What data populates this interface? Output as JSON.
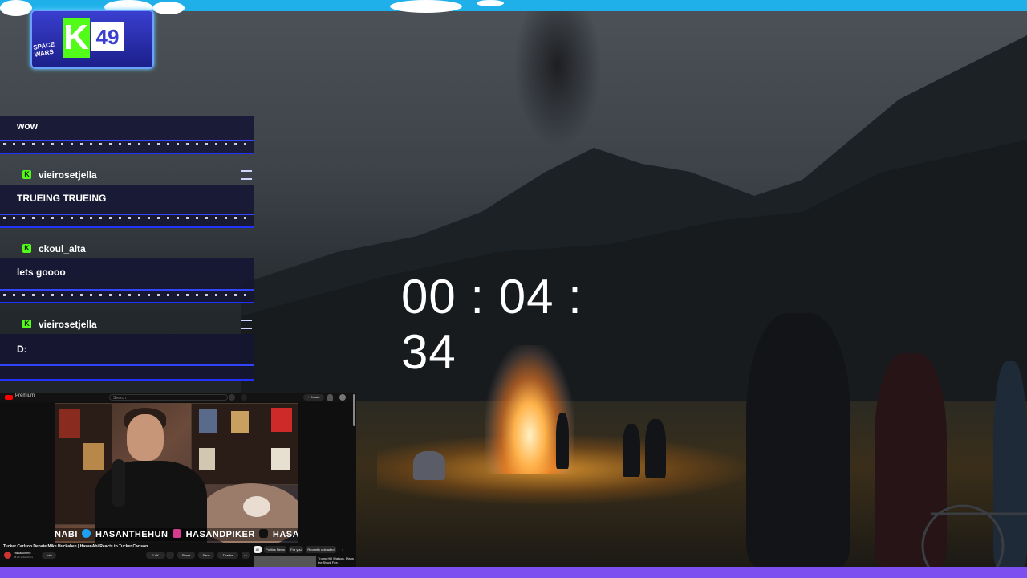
{
  "chat": {
    "messages": [
      {
        "text": "wow"
      },
      {
        "username": "vieirosetjella",
        "text": "TRUEING TRUEING"
      },
      {
        "username": "ckoul_alta",
        "text": "lets goooo"
      },
      {
        "username": "vieirosetjella",
        "text": "D:"
      }
    ],
    "platform_badge": "K"
  },
  "logo": {
    "letter": "K",
    "number": "49",
    "side_text": "SPACE WARS"
  },
  "timer": {
    "display": "00 : 04 : 34"
  },
  "youtube": {
    "premium_label": "Premium",
    "search_placeholder": "Search",
    "create_label": "+ Create",
    "video_title": "Tucker Carlson Debate Mike Huckabee | HasanAbi Reacts to Tucker Carlson",
    "channel_name": "Hasanonme",
    "channel_subs": "95.2K subscribers",
    "join_label": "Join",
    "like_count": "1.6K",
    "share_label": "Share",
    "save_label": "Save",
    "thanks_label": "Thanks",
    "banner_text": [
      "NABI",
      "HASANTHEHUN",
      "HASANDPIKER",
      "HASANDPIKER"
    ],
    "chips": [
      "All",
      "Politics News",
      "For you",
      "Recently uploaded"
    ],
    "rec_title": "Trump Hill Watson. Plans the Stock Fee."
  },
  "colors": {
    "top_bar": "#1fb0ea",
    "bottom_bar": "#7d4ff0",
    "kick_green": "#53fc18",
    "chat_lane": "#2233ff"
  }
}
